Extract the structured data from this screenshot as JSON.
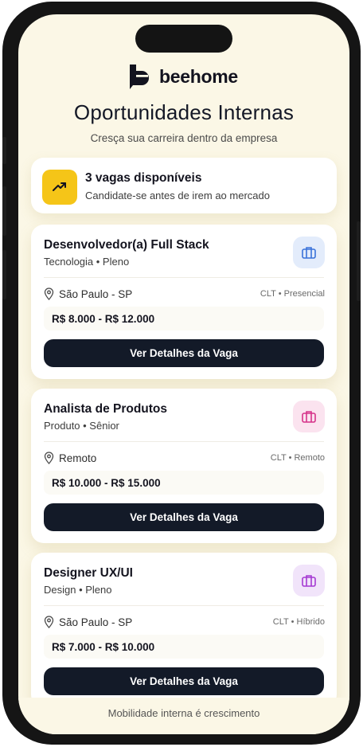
{
  "brand": {
    "name": "beehome"
  },
  "header": {
    "title": "Oportunidades Internas",
    "subtitle": "Cresça sua carreira dentro da empresa"
  },
  "summary": {
    "icon": "trending-up-icon",
    "title": "3 vagas disponíveis",
    "subtitle": "Candidate-se antes de irem ao mercado"
  },
  "jobs": [
    {
      "title": "Desenvolvedor(a) Full Stack",
      "meta": "Tecnologia • Pleno",
      "location": "São Paulo - SP",
      "contract": "CLT • Presencial",
      "salary": "R$ 8.000 - R$ 12.000",
      "button": "Ver Detalhes da Vaga",
      "icon_color": "#3b73d9",
      "icon_bg": "#e3ecfb"
    },
    {
      "title": "Analista de Produtos",
      "meta": "Produto • Sênior",
      "location": "Remoto",
      "contract": "CLT • Remoto",
      "salary": "R$ 10.000 - R$ 15.000",
      "button": "Ver Detalhes da Vaga",
      "icon_color": "#d6338a",
      "icon_bg": "#fbe3ef"
    },
    {
      "title": "Designer UX/UI",
      "meta": "Design • Pleno",
      "location": "São Paulo - SP",
      "contract": "CLT • Híbrido",
      "salary": "R$ 7.000 - R$ 10.000",
      "button": "Ver Detalhes da Vaga",
      "icon_color": "#a53ad3",
      "icon_bg": "#f1e4fa"
    }
  ],
  "footer": {
    "text": "Mobilidade interna é crescimento"
  },
  "colors": {
    "accent": "#f5c518",
    "background": "#fbf7e6",
    "button": "#131a28"
  }
}
